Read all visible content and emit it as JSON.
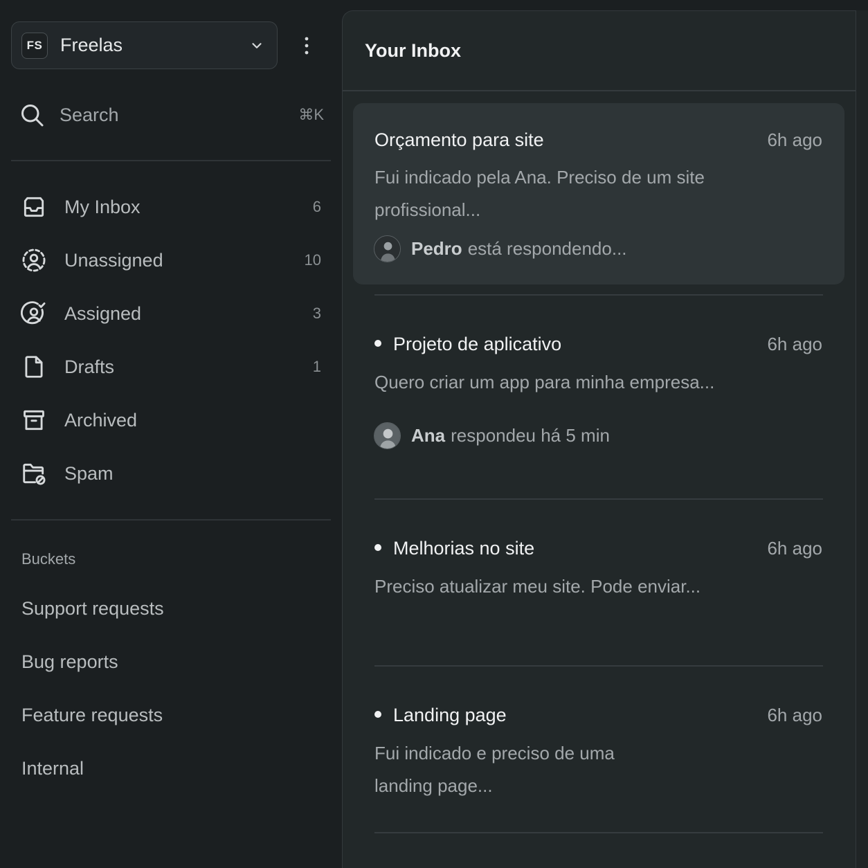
{
  "workspace": {
    "initials": "FS",
    "name": "Freelas"
  },
  "search": {
    "label": "Search",
    "shortcut": "⌘K"
  },
  "nav": [
    {
      "label": "My Inbox",
      "count": "6",
      "icon": "inbox-icon"
    },
    {
      "label": "Unassigned",
      "count": "10",
      "icon": "user-dashed-icon"
    },
    {
      "label": "Assigned",
      "count": "3",
      "icon": "user-check-icon"
    },
    {
      "label": "Drafts",
      "count": "1",
      "icon": "file-icon"
    },
    {
      "label": "Archived",
      "count": "",
      "icon": "archive-icon"
    },
    {
      "label": "Spam",
      "count": "",
      "icon": "folder-block-icon"
    }
  ],
  "buckets": {
    "heading": "Buckets",
    "items": [
      "Support requests",
      "Bug reports",
      "Feature requests",
      "Internal"
    ]
  },
  "inbox": {
    "title": "Your Inbox",
    "conversations": [
      {
        "title": "Orçamento para site",
        "time": "6h ago",
        "preview": "Fui indicado pela Ana. Preciso de um site profissional...",
        "status_who": "Pedro",
        "status_text": "está respondendo...",
        "unread": false,
        "selected": true
      },
      {
        "title": "Projeto de aplicativo",
        "time": "6h ago",
        "preview": "Quero criar um app para minha empresa...",
        "status_who": "Ana",
        "status_text": "respondeu há 5 min",
        "unread": true,
        "selected": false
      },
      {
        "title": "Melhorias no site",
        "time": "6h ago",
        "preview": "Preciso atualizar meu site. Pode enviar...",
        "unread": true,
        "selected": false
      },
      {
        "title": "Landing page",
        "time": "6h ago",
        "preview": "Fui indicado e preciso de uma landing page...",
        "unread": true,
        "selected": false
      }
    ]
  }
}
